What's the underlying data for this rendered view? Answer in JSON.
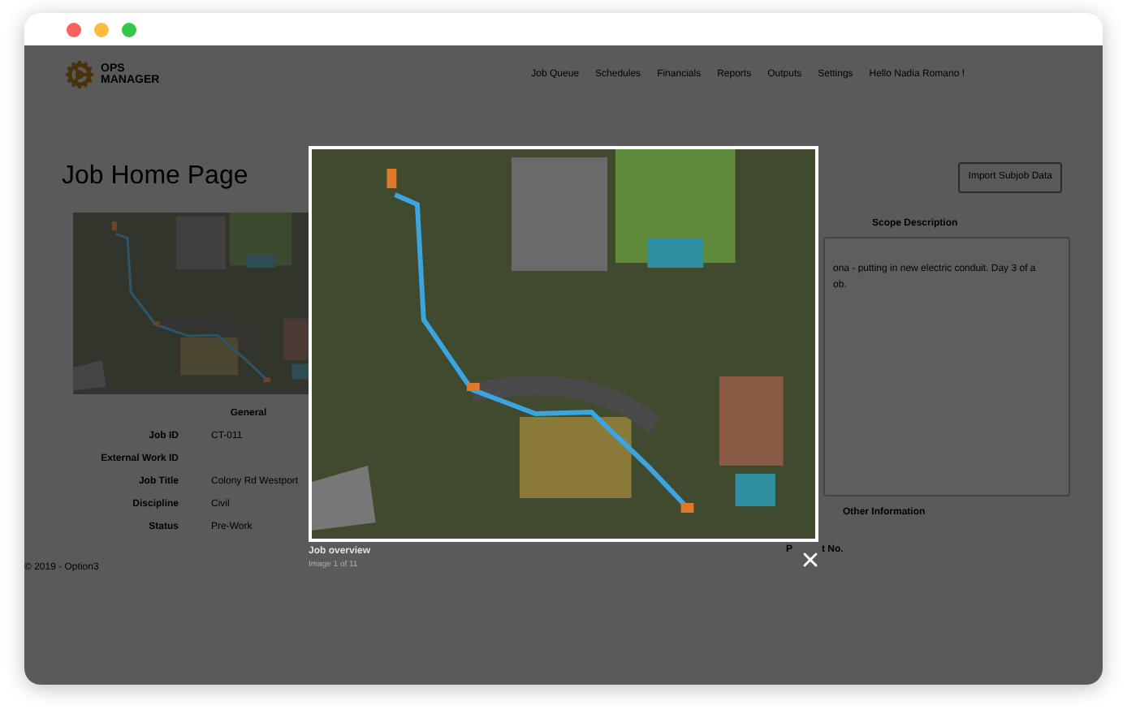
{
  "header": {
    "logo": [
      "OPS",
      "MANAGER"
    ],
    "nav": [
      "Job Queue",
      "Schedules",
      "Financials",
      "Reports",
      "Outputs",
      "Settings",
      "Hello Nadia Romano !"
    ]
  },
  "page": {
    "title": "Job Home Page",
    "import_button": "Import Subjob Data"
  },
  "general": {
    "heading": "General",
    "fields": [
      {
        "label": "Job ID",
        "value": "CT-011"
      },
      {
        "label": "External Work ID"
      },
      {
        "label": "Job Title",
        "value": "Colony Rd Westport"
      },
      {
        "label": "Discipline",
        "value": "Civil"
      },
      {
        "label": "Status",
        "value": "Pre-Work"
      }
    ]
  },
  "scope": {
    "heading": "Scope Description",
    "text_lines": [
      "ona - putting in new electric conduit. Day 3 of a",
      "ob."
    ]
  },
  "other": {
    "heading": "Other Information",
    "label_fragments": [
      "P",
      "t No."
    ]
  },
  "footer": "© 2019 - Option3",
  "lightbox": {
    "caption": "Job overview",
    "counter": "Image 1 of 11"
  }
}
